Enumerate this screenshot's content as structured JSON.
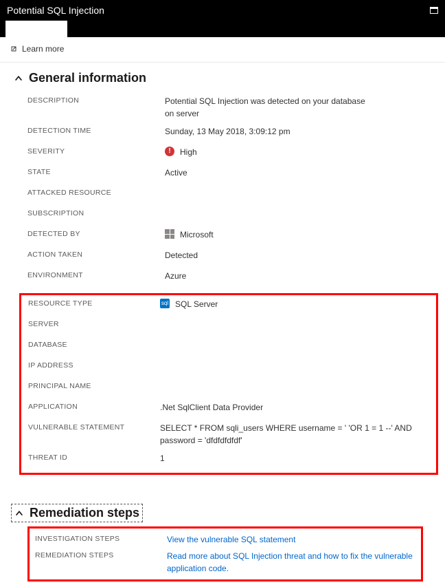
{
  "header": {
    "title": "Potential SQL Injection",
    "learn_more": "Learn more"
  },
  "general": {
    "heading": "General information",
    "rows": {
      "description_label": "DESCRIPTION",
      "description_value": "Potential SQL Injection was detected on your database on server",
      "detection_time_label": "DETECTION TIME",
      "detection_time_value": "Sunday, 13 May 2018, 3:09:12 pm",
      "severity_label": "SEVERITY",
      "severity_value": "High",
      "state_label": "STATE",
      "state_value": "Active",
      "attacked_resource_label": "ATTACKED RESOURCE",
      "attacked_resource_value": "",
      "subscription_label": "SUBSCRIPTION",
      "subscription_value": "",
      "detected_by_label": "DETECTED BY",
      "detected_by_value": "Microsoft",
      "action_taken_label": "ACTION TAKEN",
      "action_taken_value": "Detected",
      "environment_label": "ENVIRONMENT",
      "environment_value": "Azure",
      "resource_type_label": "RESOURCE TYPE",
      "resource_type_value": "SQL Server",
      "server_label": "SERVER",
      "server_value": "",
      "database_label": "DATABASE",
      "database_value": "",
      "ip_address_label": "IP ADDRESS",
      "ip_address_value": "",
      "principal_name_label": "PRINCIPAL NAME",
      "principal_name_value": "",
      "application_label": "APPLICATION",
      "application_value": ".Net SqlClient Data Provider",
      "vulnerable_statement_label": "VULNERABLE STATEMENT",
      "vulnerable_statement_value": "SELECT * FROM sqli_users WHERE username = ' 'OR 1 = 1 --' AND password = 'dfdfdfdfdf'",
      "threat_id_label": "THREAT ID",
      "threat_id_value": "1"
    }
  },
  "remediation": {
    "heading": "Remediation steps",
    "investigation_label": "INVESTIGATION STEPS",
    "investigation_value": "View the vulnerable SQL statement",
    "remediation_label": "REMEDIATION STEPS",
    "remediation_value": "Read more about SQL Injection threat and how to fix the vulnerable application code."
  }
}
